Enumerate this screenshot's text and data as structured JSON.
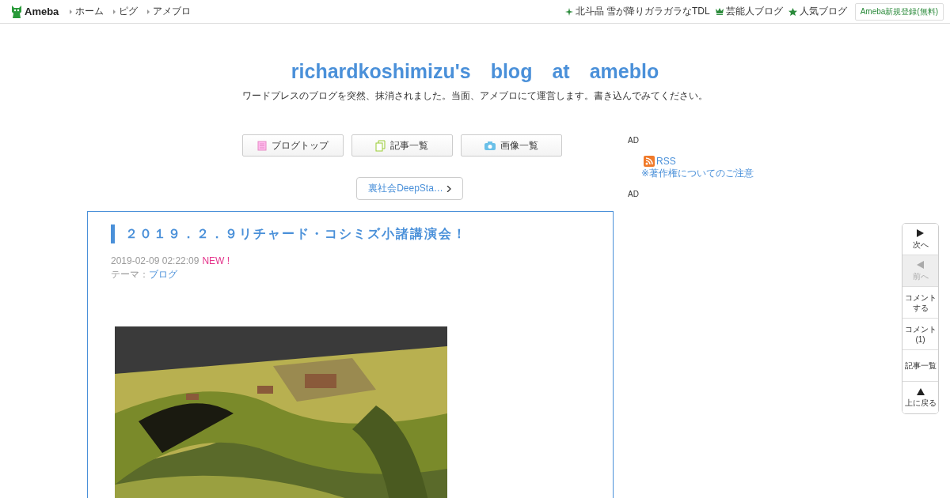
{
  "header": {
    "logo": "Ameba",
    "nav": [
      "ホーム",
      "ピグ",
      "アメブロ"
    ],
    "links": [
      {
        "kind": "sparkle",
        "label": "北斗晶 雪が降りガラガラなTDL"
      },
      {
        "kind": "crown",
        "label": "芸能人ブログ"
      },
      {
        "kind": "star",
        "label": "人気ブログ"
      }
    ],
    "register": "Ameba新規登録(無料)"
  },
  "blog": {
    "title": "richardkoshimizu's　blog　at　ameblo",
    "description": "ワードプレスのブログを突然、抹消されました。当面、アメブロにて運営します。書き込んでみてください。"
  },
  "tabs": [
    {
      "kind": "top",
      "label": "ブログトップ"
    },
    {
      "kind": "list",
      "label": "記事一覧"
    },
    {
      "label": "画像一覧"
    }
  ],
  "theme_link": "裏社会DeepSta…",
  "article": {
    "title": "２０１９．２．９リチャード・コシミズ小諸講演会！",
    "date": "2019-02-09 02:22:09",
    "badge": "NEW !",
    "theme_label": "テーマ：",
    "theme": "ブログ"
  },
  "sidebar": {
    "ad1": "AD",
    "rss": "RSS",
    "copyright": "※著作権についてのご注意",
    "ad2": "AD"
  },
  "side_nav": [
    {
      "kind": "next",
      "label": "次へ",
      "disabled": false
    },
    {
      "kind": "prev",
      "label": "前へ",
      "disabled": true
    },
    {
      "kind": "text",
      "label": "コメントする",
      "disabled": false
    },
    {
      "kind": "text",
      "label": "コメント(1)",
      "disabled": false
    },
    {
      "kind": "text",
      "label": "記事一覧",
      "disabled": false
    },
    {
      "kind": "top",
      "label": "上に戻る",
      "disabled": false
    }
  ]
}
